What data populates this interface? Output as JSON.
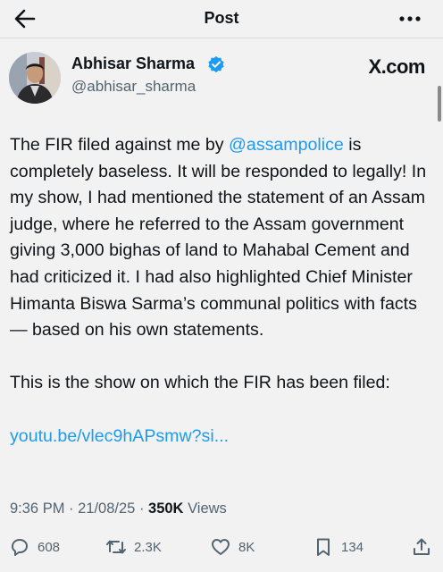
{
  "header": {
    "title": "Post",
    "back_icon": "arrow-left-icon",
    "more_icon": "more-dots-icon"
  },
  "author": {
    "name": "Abhisar Sharma",
    "handle": "@abhisar_sharma",
    "verified": true
  },
  "brand": "X.com",
  "post": {
    "p1_before": "The FIR filed against me by ",
    "mention": "@assampolice",
    "p1_after": " is completely baseless. It will be responded to legally! In my show, I had mentioned the statement of an Assam judge, where he referred to the Assam government giving 3,000 bighas of land to Mahabal Cement and had criticized it. I had also highlighted Chief Minister Himanta Biswa Sarma’s communal politics with facts — based on his own statements.",
    "p2": "This is the show on which the FIR has been filed:",
    "link": "youtu.be/vlec9hAPsmw?si..."
  },
  "meta": {
    "time": "9:36 PM",
    "date": "21/08/25",
    "views_count": "350K",
    "views_label": "Views",
    "sep": " · "
  },
  "actions": {
    "replies": "608",
    "reposts": "2.3K",
    "likes": "8K",
    "bookmarks": "134"
  },
  "colors": {
    "accent": "#1d9bf0",
    "background": "#f2f2f2",
    "text": "#0f1419",
    "muted": "#536471"
  }
}
